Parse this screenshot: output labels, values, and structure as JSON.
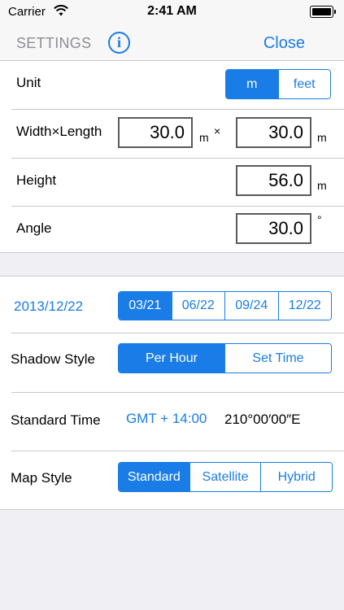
{
  "status_bar": {
    "carrier": "Carrier",
    "time": "2:41 AM"
  },
  "nav": {
    "title": "SETTINGS",
    "info_icon": "i",
    "close_label": "Close"
  },
  "settings": {
    "unit_label": "Unit",
    "unit_options": [
      "m",
      "feet"
    ],
    "unit_selected": "m",
    "width_length_label": "Width×Length",
    "width_value": "30.0",
    "width_unit": "m",
    "times_sign": "×",
    "length_value": "30.0",
    "length_unit": "m",
    "height_label": "Height",
    "height_value": "56.0",
    "height_unit": "m",
    "angle_label": "Angle",
    "angle_value": "30.0",
    "angle_unit": "°"
  },
  "shadow": {
    "date": "2013/12/22",
    "date_presets": [
      "03/21",
      "06/22",
      "09/24",
      "12/22"
    ],
    "date_selected": "03/21",
    "shadow_style_label": "Shadow Style",
    "shadow_style_options": [
      "Per Hour",
      "Set Time"
    ],
    "shadow_style_selected": "Per Hour",
    "standard_time_label": "Standard Time",
    "standard_time_offset": "GMT + 14:00",
    "standard_time_longitude": "210°00′00″E",
    "map_style_label": "Map Style",
    "map_style_options": [
      "Standard",
      "Satellite",
      "Hybrid"
    ],
    "map_style_selected": "Standard"
  },
  "colors": {
    "accent": "#1a7ce6",
    "background": "#efeff4",
    "separator": "#c8c7cc"
  }
}
